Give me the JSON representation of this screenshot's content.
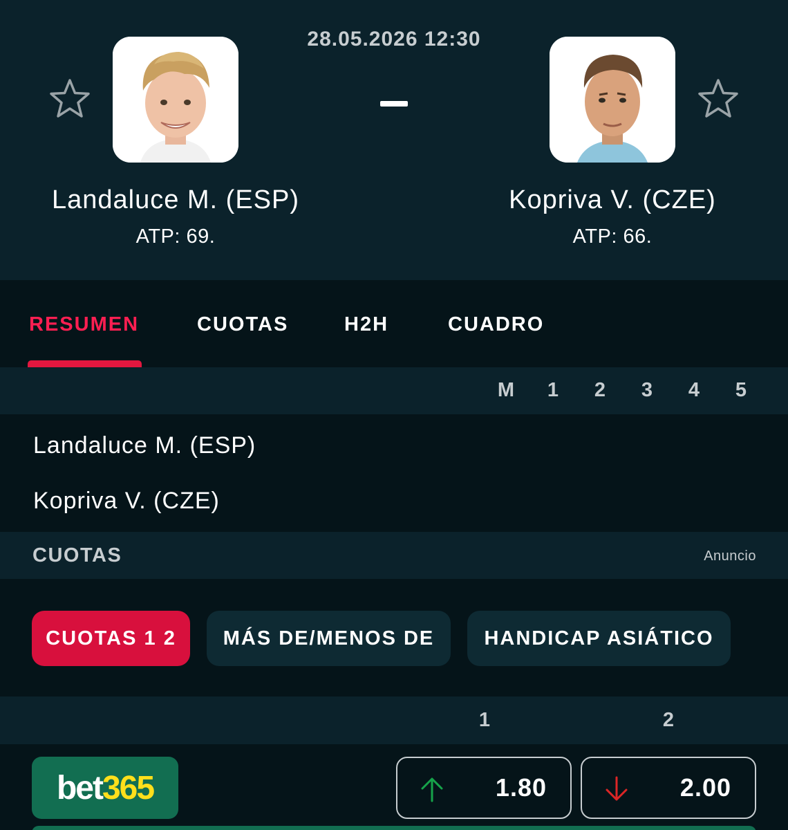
{
  "match": {
    "datetime": "28.05.2026 12:30",
    "score_separator": "-"
  },
  "home": {
    "name": "Landaluce M. (ESP)",
    "rank": "ATP: 69.",
    "favorite_icon": "star-outline-icon"
  },
  "away": {
    "name": "Kopriva V. (CZE)",
    "rank": "ATP: 66.",
    "favorite_icon": "star-outline-icon"
  },
  "tabs": [
    {
      "label": "RESUMEN",
      "active": true
    },
    {
      "label": "CUOTAS",
      "active": false
    },
    {
      "label": "H2H",
      "active": false
    },
    {
      "label": "CUADRO",
      "active": false
    }
  ],
  "scoreboard": {
    "columns": [
      "M",
      "1",
      "2",
      "3",
      "4",
      "5"
    ],
    "rows": [
      {
        "player": "Landaluce M. (ESP)"
      },
      {
        "player": "Kopriva V. (CZE)"
      }
    ]
  },
  "odds": {
    "title": "CUOTAS",
    "ad_label": "Anuncio",
    "filters": [
      {
        "label": "CUOTAS 1 2",
        "active": true
      },
      {
        "label": "MÁS DE/MENOS DE",
        "active": false
      },
      {
        "label": "HANDICAP ASIÁTICO",
        "active": false
      }
    ],
    "columns": [
      "1",
      "2"
    ],
    "bookmaker": {
      "part1": "bet",
      "part2": "365"
    },
    "prices": [
      {
        "value": "1.80",
        "trend": "up",
        "icon": "arrow-up-icon"
      },
      {
        "value": "2.00",
        "trend": "down",
        "icon": "arrow-down-icon"
      }
    ]
  },
  "colors": {
    "accent": "#e3173f",
    "background": "#051419",
    "panel": "#0b222b",
    "bet365_green": "#126e51",
    "bet365_yellow": "#ffdf1b",
    "trend_up": "#16a34a",
    "trend_down": "#dc2626"
  }
}
